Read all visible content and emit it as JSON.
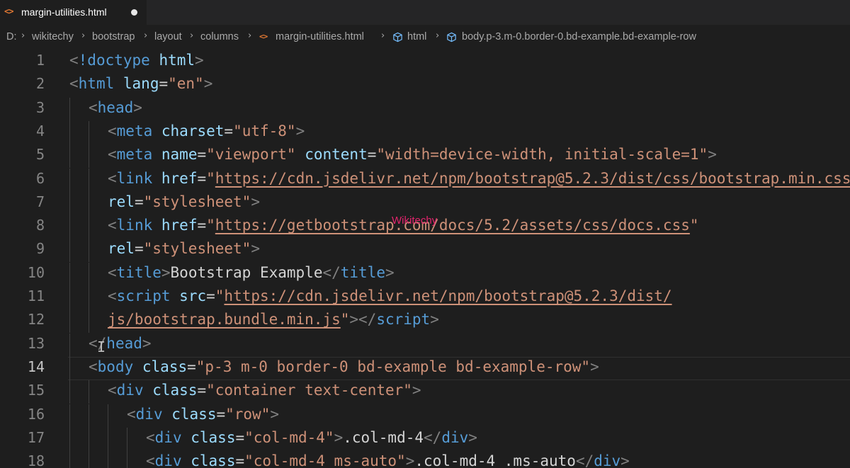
{
  "tab": {
    "icon": "<>",
    "label": "margin-utilities.html",
    "dirty": true
  },
  "breadcrumb": [
    "D:",
    "wikitechy",
    "bootstrap",
    "layout",
    "columns",
    "margin-utilities.html",
    "html",
    "body.p-3.m-0.border-0.bd-example.bd-example-row"
  ],
  "breadcrumb_icons": {
    "file": "html-file-icon",
    "symbol": "cube-symbol-icon",
    "separator": "chevron-right-icon"
  },
  "editor": {
    "current_line": 14,
    "lines": [
      {
        "n": "1",
        "tokens": [
          [
            "p",
            "<"
          ],
          [
            "t",
            "!doctype"
          ],
          [
            "tx",
            " "
          ],
          [
            "a",
            "html"
          ],
          [
            "p",
            ">"
          ]
        ]
      },
      {
        "n": "2",
        "tokens": [
          [
            "p",
            "<"
          ],
          [
            "t",
            "html"
          ],
          [
            "tx",
            " "
          ],
          [
            "a",
            "lang"
          ],
          [
            "tx",
            "="
          ],
          [
            "s",
            "\"en\""
          ],
          [
            "p",
            ">"
          ]
        ]
      },
      {
        "n": "3",
        "tokens": [
          [
            "p",
            "<"
          ],
          [
            "t",
            "head"
          ],
          [
            "p",
            ">"
          ]
        ]
      },
      {
        "n": "4",
        "tokens": [
          [
            "p",
            "<"
          ],
          [
            "t",
            "meta"
          ],
          [
            "tx",
            " "
          ],
          [
            "a",
            "charset"
          ],
          [
            "tx",
            "="
          ],
          [
            "s",
            "\"utf-8\""
          ],
          [
            "p",
            ">"
          ]
        ]
      },
      {
        "n": "5",
        "tokens": [
          [
            "p",
            "<"
          ],
          [
            "t",
            "meta"
          ],
          [
            "tx",
            " "
          ],
          [
            "a",
            "name"
          ],
          [
            "tx",
            "="
          ],
          [
            "s",
            "\"viewport\""
          ],
          [
            "tx",
            " "
          ],
          [
            "a",
            "content"
          ],
          [
            "tx",
            "="
          ],
          [
            "s",
            "\"width=device-width, initial-scale=1\""
          ],
          [
            "p",
            ">"
          ]
        ]
      },
      {
        "n": "6",
        "tokens": [
          [
            "p",
            "<"
          ],
          [
            "t",
            "link"
          ],
          [
            "tx",
            " "
          ],
          [
            "a",
            "href"
          ],
          [
            "tx",
            "="
          ],
          [
            "s",
            "\""
          ],
          [
            "u",
            "https://cdn.jsdelivr.net/npm/bootstrap@5.2.3/dist/css/bootstrap.min.css"
          ]
        ]
      },
      {
        "n": "7",
        "tokens": [
          [
            "a",
            "rel"
          ],
          [
            "tx",
            "="
          ],
          [
            "s",
            "\"stylesheet\""
          ],
          [
            "p",
            ">"
          ]
        ]
      },
      {
        "n": "8",
        "tokens": [
          [
            "p",
            "<"
          ],
          [
            "t",
            "link"
          ],
          [
            "tx",
            " "
          ],
          [
            "a",
            "href"
          ],
          [
            "tx",
            "="
          ],
          [
            "s",
            "\""
          ],
          [
            "u",
            "https://getbootstrap.com/docs/5.2/assets/css/docs.css"
          ],
          [
            "s",
            "\""
          ]
        ]
      },
      {
        "n": "9",
        "tokens": [
          [
            "a",
            "rel"
          ],
          [
            "tx",
            "="
          ],
          [
            "s",
            "\"stylesheet\""
          ],
          [
            "p",
            ">"
          ]
        ]
      },
      {
        "n": "10",
        "tokens": [
          [
            "p",
            "<"
          ],
          [
            "t",
            "title"
          ],
          [
            "p",
            ">"
          ],
          [
            "tx",
            "Bootstrap Example"
          ],
          [
            "p",
            "</"
          ],
          [
            "t",
            "title"
          ],
          [
            "p",
            ">"
          ]
        ]
      },
      {
        "n": "11",
        "tokens": [
          [
            "p",
            "<"
          ],
          [
            "t",
            "script"
          ],
          [
            "tx",
            " "
          ],
          [
            "a",
            "src"
          ],
          [
            "tx",
            "="
          ],
          [
            "s",
            "\""
          ],
          [
            "u",
            "https://cdn.jsdelivr.net/npm/bootstrap@5.2.3/dist/"
          ]
        ]
      },
      {
        "n": "12",
        "tokens": [
          [
            "u",
            "js/bootstrap.bundle.min.js"
          ],
          [
            "s",
            "\""
          ],
          [
            "p",
            "></"
          ],
          [
            "t",
            "script"
          ],
          [
            "p",
            ">"
          ]
        ]
      },
      {
        "n": "13",
        "tokens": [
          [
            "p",
            "</"
          ],
          [
            "t",
            "head"
          ],
          [
            "p",
            ">"
          ]
        ]
      },
      {
        "n": "14",
        "tokens": [
          [
            "p",
            "<"
          ],
          [
            "t",
            "body"
          ],
          [
            "tx",
            " "
          ],
          [
            "a",
            "class"
          ],
          [
            "tx",
            "="
          ],
          [
            "s",
            "\"p-3 m-0 border-0 bd-example bd-example-row\""
          ],
          [
            "p",
            ">"
          ]
        ]
      },
      {
        "n": "15",
        "tokens": [
          [
            "p",
            "<"
          ],
          [
            "t",
            "div"
          ],
          [
            "tx",
            " "
          ],
          [
            "a",
            "class"
          ],
          [
            "tx",
            "="
          ],
          [
            "s",
            "\"container text-center\""
          ],
          [
            "p",
            ">"
          ]
        ]
      },
      {
        "n": "16",
        "tokens": [
          [
            "p",
            "<"
          ],
          [
            "t",
            "div"
          ],
          [
            "tx",
            " "
          ],
          [
            "a",
            "class"
          ],
          [
            "tx",
            "="
          ],
          [
            "s",
            "\"row\""
          ],
          [
            "p",
            ">"
          ]
        ]
      },
      {
        "n": "17",
        "tokens": [
          [
            "p",
            "<"
          ],
          [
            "t",
            "div"
          ],
          [
            "tx",
            " "
          ],
          [
            "a",
            "class"
          ],
          [
            "tx",
            "="
          ],
          [
            "s",
            "\"col-md-4\""
          ],
          [
            "p",
            ">"
          ],
          [
            "tx",
            ".col-md-4"
          ],
          [
            "p",
            "</"
          ],
          [
            "t",
            "div"
          ],
          [
            "p",
            ">"
          ]
        ]
      },
      {
        "n": "18",
        "tokens": [
          [
            "p",
            "<"
          ],
          [
            "t",
            "div"
          ],
          [
            "tx",
            " "
          ],
          [
            "a",
            "class"
          ],
          [
            "tx",
            "="
          ],
          [
            "s",
            "\"col-md-4 ms-auto\""
          ],
          [
            "p",
            ">"
          ],
          [
            "tx",
            ".col-md-4 .ms-auto"
          ],
          [
            "p",
            "</"
          ],
          [
            "t",
            "div"
          ],
          [
            "p",
            ">"
          ]
        ]
      }
    ]
  },
  "watermark": "Wikitechy",
  "cursor_icon": "text-cursor-icon",
  "colors": {
    "background": "#1e1e1e",
    "tag": "#569cd6",
    "attribute": "#9cdcfe",
    "string": "#ce9178",
    "punctuation": "#808080",
    "text": "#d4d4d4",
    "line_number": "#858585",
    "html_icon": "#e37933",
    "watermark": "#e2246c"
  }
}
